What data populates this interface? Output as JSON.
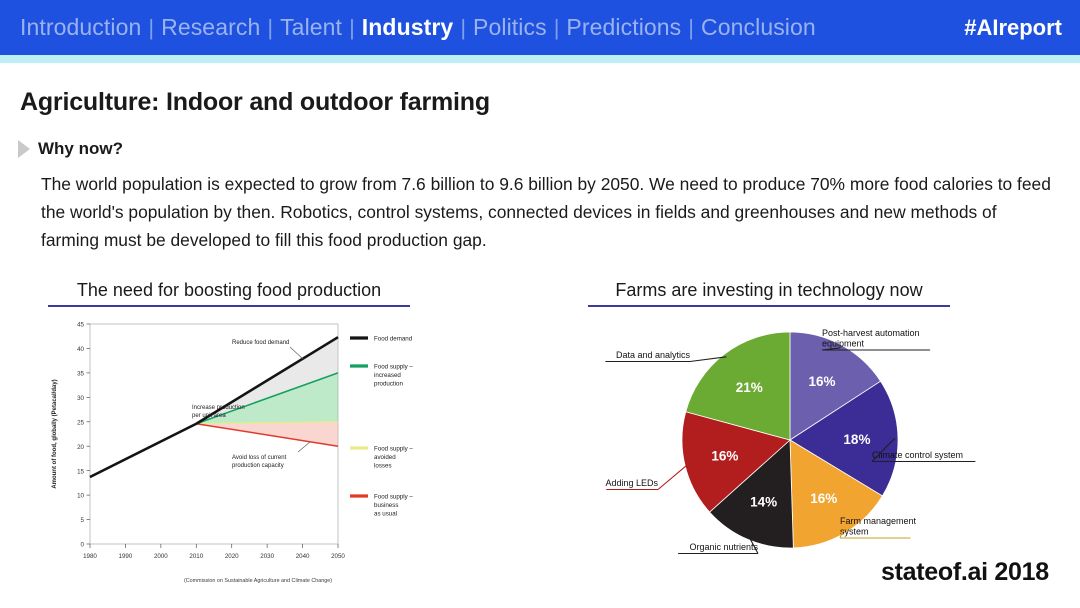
{
  "nav": {
    "items": [
      {
        "label": "Introduction",
        "active": false
      },
      {
        "label": "Research",
        "active": false
      },
      {
        "label": "Talent",
        "active": false
      },
      {
        "label": "Industry",
        "active": true
      },
      {
        "label": "Politics",
        "active": false
      },
      {
        "label": "Predictions",
        "active": false
      },
      {
        "label": "Conclusion",
        "active": false
      }
    ],
    "separator": "|",
    "hashtag": "#AIreport",
    "bar_color": "#1f51e0",
    "underline_color": "#bdf0f5"
  },
  "slide": {
    "title": "Agriculture: Indoor and outdoor farming",
    "why_label": "Why now?",
    "body": "The world population is expected to grow from 7.6 billion to 9.6 billion by 2050. We need to produce 70% more food calories to feed the world's population by then. Robotics, control systems, connected devices in fields and greenhouses and new methods of farming must be developed to fill this food production gap.",
    "footer_brand": "stateof.ai 2018",
    "accent_color": "#3b3b9e"
  },
  "panels": {
    "left_caption": "The need for boosting food production",
    "right_caption": "Farms are investing in technology now"
  },
  "chart_data": [
    {
      "type": "line",
      "title": "The need for boosting food production",
      "xlabel": "",
      "ylabel": "Amount of food, globally (Petacal/day)",
      "source": "(Commission on Sustainable Agriculture and Climate Change)",
      "xlim": [
        1980,
        2050
      ],
      "ylim": [
        0,
        45
      ],
      "xticks": [
        1980,
        1990,
        2000,
        2010,
        2020,
        2030,
        2040,
        2050
      ],
      "yticks": [
        0,
        5,
        10,
        15,
        20,
        25,
        30,
        35,
        40,
        45
      ],
      "grid": false,
      "legend_position": "right",
      "series": [
        {
          "name": "Food demand",
          "color": "#141414",
          "x": [
            1980,
            2010,
            2050
          ],
          "values": [
            13.7,
            24.6,
            42.3
          ]
        },
        {
          "name": "Food supply – increased production",
          "color": "#17a05e",
          "x": [
            1980,
            2010,
            2050
          ],
          "values": [
            13.7,
            24.6,
            35.0
          ]
        },
        {
          "name": "Food supply – avoided losses",
          "color": "#e8eb8b",
          "x": [
            1980,
            2010,
            2050
          ],
          "values": [
            13.7,
            24.6,
            25.0
          ]
        },
        {
          "name": "Food supply – business as usual",
          "color": "#e03a2c",
          "x": [
            1980,
            2010,
            2050
          ],
          "values": [
            13.7,
            24.6,
            20.0
          ]
        }
      ],
      "annotations": [
        "Reduce food demand",
        "Increase production per unit area",
        "Avoid loss of current production capacity"
      ]
    },
    {
      "type": "pie",
      "title": "Farms are investing in technology now",
      "labels": [
        "Post-harvest automation equipment",
        "Climate control system",
        "Farm management system",
        "Organic nutrients",
        "Adding LEDs",
        "Data and analytics"
      ],
      "values": [
        16,
        18,
        16,
        14,
        16,
        21
      ],
      "value_labels": [
        "16%",
        "18%",
        "16%",
        "14%",
        "16%",
        "21%"
      ],
      "colors": [
        "#6b5fae",
        "#3b2c96",
        "#f2a430",
        "#231f20",
        "#b21e1e",
        "#6cab33"
      ],
      "legend_position": "callouts"
    }
  ]
}
